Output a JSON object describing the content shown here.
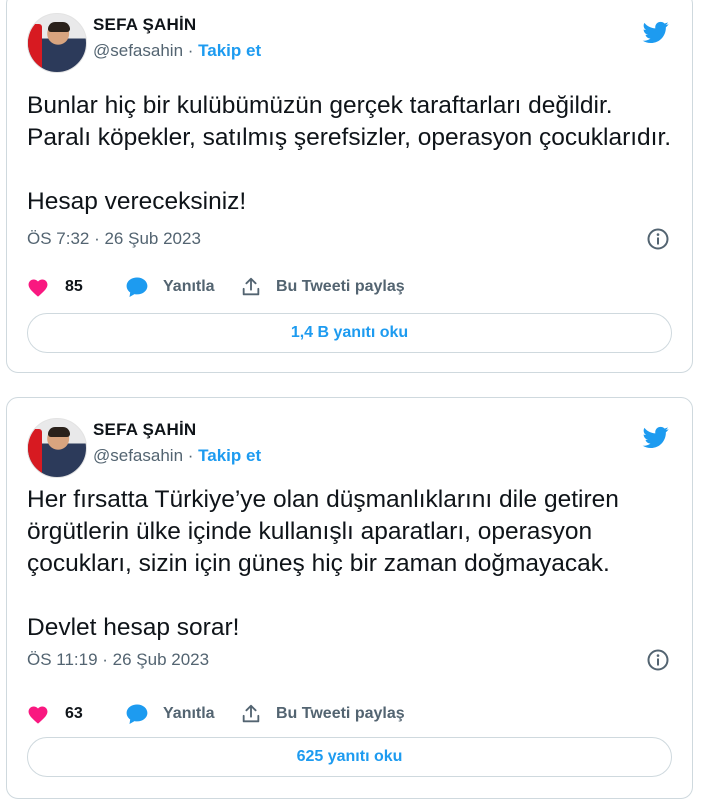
{
  "colors": {
    "accent": "#1d9bf0",
    "like": "#f91880",
    "secondary_text": "#536471",
    "border": "#cfd9de"
  },
  "tweets": [
    {
      "author_name": "SEFA ŞAHİN",
      "handle": "@sefasahin",
      "separator": " · ",
      "follow_label": "Takip et",
      "text": "Bunlar hiç bir kulübümüzün gerçek taraftarları değildir.\nParalı köpekler, satılmış şerefsizler, operasyon çocuklarıdır.\n\nHesap vereceksiniz!",
      "timestamp": "ÖS 7:32 · 26 Şub 2023",
      "likes": "85",
      "reply_label": "Yanıtla",
      "share_label": "Bu Tweeti paylaş",
      "read_replies_label": "1,4 B yanıtı oku",
      "icons": [
        "twitter-bird-icon",
        "info-icon",
        "heart-icon",
        "reply-bubble-icon",
        "share-icon"
      ]
    },
    {
      "author_name": "SEFA ŞAHİN",
      "handle": "@sefasahin",
      "separator": " · ",
      "follow_label": "Takip et",
      "text": "Her fırsatta Türkiye’ye olan düşmanlıklarını dile getiren\nörgütlerin ülke içinde kullanışlı aparatları, operasyon\nçocukları, sizin için güneş hiç bir zaman doğmayacak.\n\nDevlet hesap sorar!",
      "timestamp": "ÖS 11:19 · 26 Şub 2023",
      "likes": "63",
      "reply_label": "Yanıtla",
      "share_label": "Bu Tweeti paylaş",
      "read_replies_label": "625 yanıtı oku",
      "icons": [
        "twitter-bird-icon",
        "info-icon",
        "heart-icon",
        "reply-bubble-icon",
        "share-icon"
      ]
    }
  ]
}
